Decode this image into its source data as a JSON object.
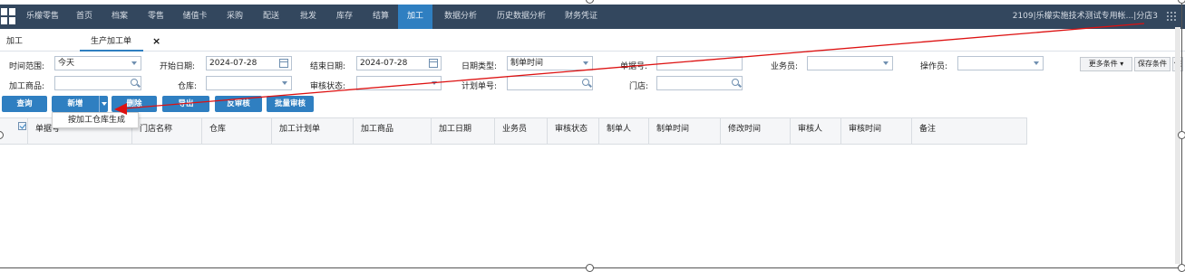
{
  "topnav": {
    "items": [
      "乐檬零售",
      "首页",
      "档案",
      "零售",
      "储值卡",
      "采购",
      "配送",
      "批发",
      "库存",
      "结算",
      "加工",
      "数据分析",
      "历史数据分析",
      "财务凭证"
    ],
    "active_index": 10,
    "store_info": "2109|乐檬实施技术测试专用帐...|分店3",
    "bg_color": "#33475e",
    "active_color": "#2f7fc1"
  },
  "tabs": {
    "items": [
      "加工",
      "生产加工单"
    ],
    "active_index": 1,
    "close_glyph": "×"
  },
  "filters": {
    "time_range": {
      "label": "时间范围:",
      "value": "今天"
    },
    "start_date": {
      "label": "开始日期:",
      "value": "2024-07-28"
    },
    "end_date": {
      "label": "结束日期:",
      "value": "2024-07-28"
    },
    "date_type": {
      "label": "日期类型:",
      "value": "制单时间"
    },
    "doc_no": {
      "label": "单据号:",
      "value": ""
    },
    "salesperson": {
      "label": "业务员:",
      "value": ""
    },
    "operator": {
      "label": "操作员:",
      "value": ""
    },
    "product": {
      "label": "加工商品:",
      "value": ""
    },
    "warehouse": {
      "label": "仓库:",
      "value": ""
    },
    "audit_status": {
      "label": "审核状态:",
      "value": ""
    },
    "plan_no": {
      "label": "计划单号:",
      "value": ""
    },
    "store": {
      "label": "门店:",
      "value": ""
    },
    "more_conditions": "更多条件",
    "save_conditions": "保存条件",
    "truncated_button": "保"
  },
  "toolbar": {
    "query": "查询",
    "add": "新增",
    "delete": "删除",
    "export": "导出",
    "unaudit": "反审核",
    "batch_audit": "批量审核"
  },
  "add_menu": {
    "items": [
      "按加工仓库生成"
    ]
  },
  "grid": {
    "columns": [
      "单据号",
      "门店名称",
      "仓库",
      "加工计划单",
      "加工商品",
      "加工日期",
      "业务员",
      "审核状态",
      "制单人",
      "制单时间",
      "修改时间",
      "审核人",
      "审核时间",
      "备注"
    ]
  },
  "annotation": {
    "arrow_color": "#dd1111"
  }
}
